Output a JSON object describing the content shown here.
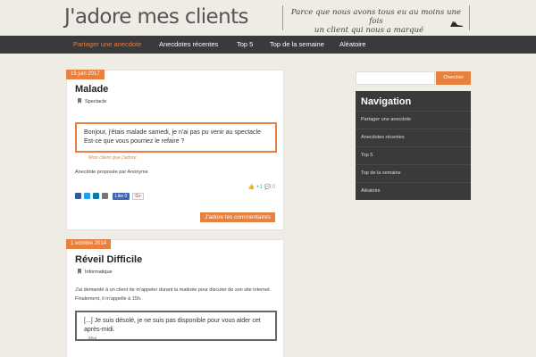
{
  "site": {
    "title": "J'adore mes clients",
    "tagline_line1": "Parce que nous avons tous eu au moins une fois",
    "tagline_line2": "un client qui nous a marqué"
  },
  "nav": {
    "items": [
      {
        "label": "Partager une anecdote",
        "active": true
      },
      {
        "label": "Anecdotes récentes"
      },
      {
        "label": "Top 5"
      },
      {
        "label": "Top de la semaine"
      },
      {
        "label": "Aléatoire"
      }
    ]
  },
  "posts": [
    {
      "date": "15 juin 2017",
      "title": "Malade",
      "category": "Spectacle",
      "quote": "Bonjour, j'étais malade samedi, je n'ai pas pu venir au spectacle Est-ce que vous pourriez le refaire ?",
      "quote_author": "Mon client que j'adore",
      "proposed_by": "Anecdote proposée par Anonyme",
      "like_label": "Like 0",
      "gplus_label": "G+",
      "votes_plus": "+1",
      "comments_count": "0",
      "cta": "J'adore les commentaires"
    },
    {
      "date": "1 octobre 2014",
      "title": "Réveil Difficile",
      "category": "Informatique",
      "intro": "J'ai demandé à un client de m'appeler durant la matinée pour discuter de son site internet. Finalement, il m'appelle à 15h.",
      "quote": "[...] Je suis désolé, je ne suis pas disponible pour vous aider cet après-midi.",
      "quote_author": "Moi"
    }
  ],
  "sidebar": {
    "search_button": "Chercher",
    "nav_title": "Navigation",
    "items": [
      "Partager une anecdote",
      "Anecdotes récentes",
      "Top 5",
      "Top de la semaine",
      "Aléatoire"
    ]
  },
  "colors": {
    "accent": "#e8813f",
    "nav_bg": "#3a3a3a",
    "page_bg": "#efece6"
  }
}
